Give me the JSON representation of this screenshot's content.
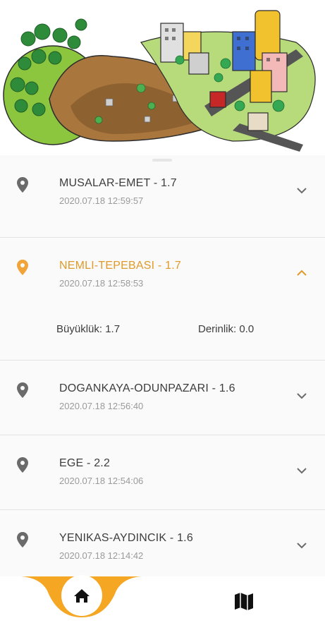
{
  "earthquakes": [
    {
      "title": "MUSALAR-EMET - 1.7",
      "time": "2020.07.18 12:59:57",
      "expanded": false
    },
    {
      "title": "NEMLI-TEPEBASI - 1.7",
      "time": "2020.07.18 12:58:53",
      "expanded": true,
      "magnitude_label": "Büyüklük: 1.7",
      "depth_label": "Derinlik: 0.0"
    },
    {
      "title": "DOGANKAYA-ODUNPAZARI - 1.6",
      "time": "2020.07.18 12:56:40",
      "expanded": false
    },
    {
      "title": "EGE - 2.2",
      "time": "2020.07.18 12:54:06",
      "expanded": false
    },
    {
      "title": "YENIKAS-AYDINCIK - 1.6",
      "time": "2020.07.18 12:14:42",
      "expanded": false
    }
  ],
  "nav": {
    "items": [
      {
        "icon": "home-icon",
        "active": true
      },
      {
        "icon": "map-icon",
        "active": false
      }
    ]
  },
  "colors": {
    "accent": "#f5a623",
    "expanded_title": "#e09a2a",
    "pin_default": "#6b6b6b",
    "pin_active": "#f0a43a"
  }
}
